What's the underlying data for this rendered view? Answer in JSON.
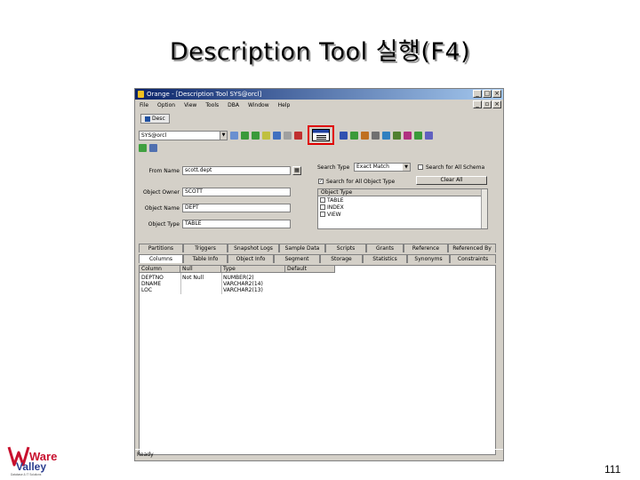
{
  "slide": {
    "title": "Description Tool 실행(F4)",
    "page_number": "111"
  },
  "logo": {
    "line1": "Ware",
    "line2": "Valley",
    "tagline": "Database & IT Solutions"
  },
  "window": {
    "title": "Orange - [Description Tool SYS@orcl]",
    "menu": [
      "File",
      "Option",
      "View",
      "Tools",
      "DBA",
      "Window",
      "Help"
    ],
    "tab_label": "Desc",
    "connection": "SYS@orcl",
    "statusbar": "Ready"
  },
  "form": {
    "from_name_label": "From Name",
    "from_name_value": "scott.dept",
    "object_owner_label": "Object Owner",
    "object_owner_value": "SCOTT",
    "object_name_label": "Object Name",
    "object_name_value": "DEPT",
    "object_type_label": "Object Type",
    "object_type_value": "TABLE"
  },
  "search": {
    "type_label": "Search Type",
    "type_value": "Exact Match",
    "all_schema_label": "Search for All Schema",
    "all_object_type_label": "Search for All Object Type",
    "clear_all_label": "Clear All",
    "list_header": "Object Type",
    "object_types": [
      "TABLE",
      "INDEX",
      "VIEW"
    ]
  },
  "tabs_top": [
    "Partitions",
    "Triggers",
    "Snapshot Logs",
    "Sample Data",
    "Scripts",
    "Grants",
    "Reference",
    "Referenced By"
  ],
  "tabs_bottom": [
    "Columns",
    "Table Info",
    "Object Info",
    "Segment",
    "Storage",
    "Statistics",
    "Synonyms",
    "Constraints"
  ],
  "grid": {
    "headers": [
      "Column",
      "Null",
      "Type",
      "Default"
    ],
    "rows": [
      [
        "DEPTNO",
        "Not Null",
        "NUMBER(2)",
        ""
      ],
      [
        "DNAME",
        "",
        "VARCHAR2(14)",
        ""
      ],
      [
        "LOC",
        "",
        "VARCHAR2(13)",
        ""
      ]
    ]
  },
  "colors": {
    "highlight": "#e00000",
    "title_bar": "#0a246a",
    "window_face": "#d4d0c8"
  }
}
